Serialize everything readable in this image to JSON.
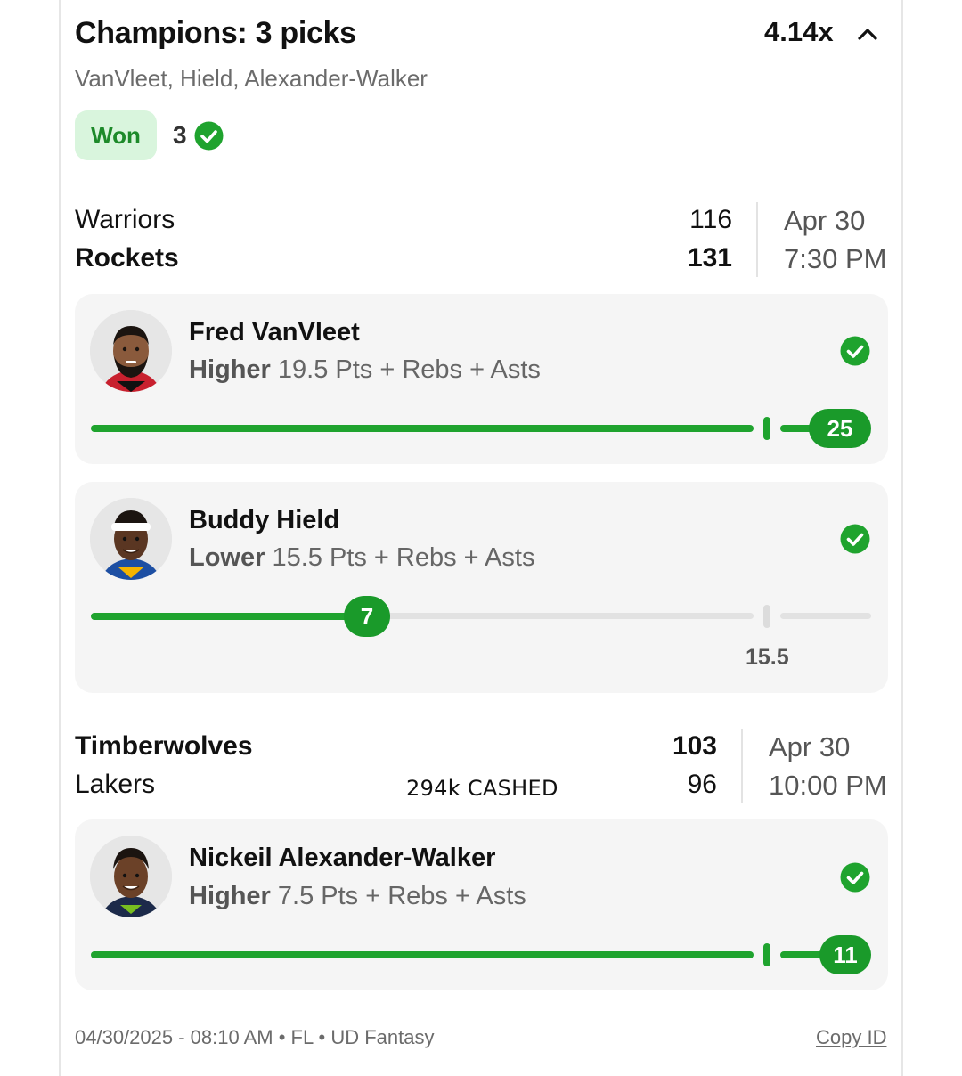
{
  "entry": {
    "title": "Champions: 3 picks",
    "multiplier": "4.14x",
    "players_summary": "VanVleet, Hield, Alexander-Walker",
    "status_label": "Won",
    "won_count": "3"
  },
  "games": [
    {
      "team1": "Warriors",
      "score1": "116",
      "team2": "Rockets",
      "score2": "131",
      "date": "Apr 30",
      "time": "7:30 PM"
    },
    {
      "team1": "Timberwolves",
      "score1": "103",
      "team2": "Lakers",
      "score2": "96",
      "date": "Apr 30",
      "time": "10:00 PM"
    }
  ],
  "picks": [
    {
      "name": "Fred VanVleet",
      "direction": "Higher",
      "line_text": "19.5 Pts + Rebs + Asts",
      "result": "25",
      "line": 19.5
    },
    {
      "name": "Buddy Hield",
      "direction": "Lower",
      "line_text": "15.5 Pts + Rebs + Asts",
      "result": "7",
      "line": 15.5,
      "line_label": "15.5"
    },
    {
      "name": "Nickeil Alexander-Walker",
      "direction": "Higher",
      "line_text": "7.5 Pts + Rebs + Asts",
      "result": "11",
      "line": 7.5
    }
  ],
  "overlay_text": "294k CASHED",
  "footer": {
    "meta": "04/30/2025 - 08:10 AM • FL • UD Fantasy",
    "copy_id": "Copy ID"
  },
  "colors": {
    "accent_green": "#1fa32e",
    "badge_bg": "#d9f5dd",
    "card_bg": "#f5f5f5"
  },
  "icons": [
    "chevron-up-icon",
    "check-circle-icon",
    "player-avatar"
  ]
}
